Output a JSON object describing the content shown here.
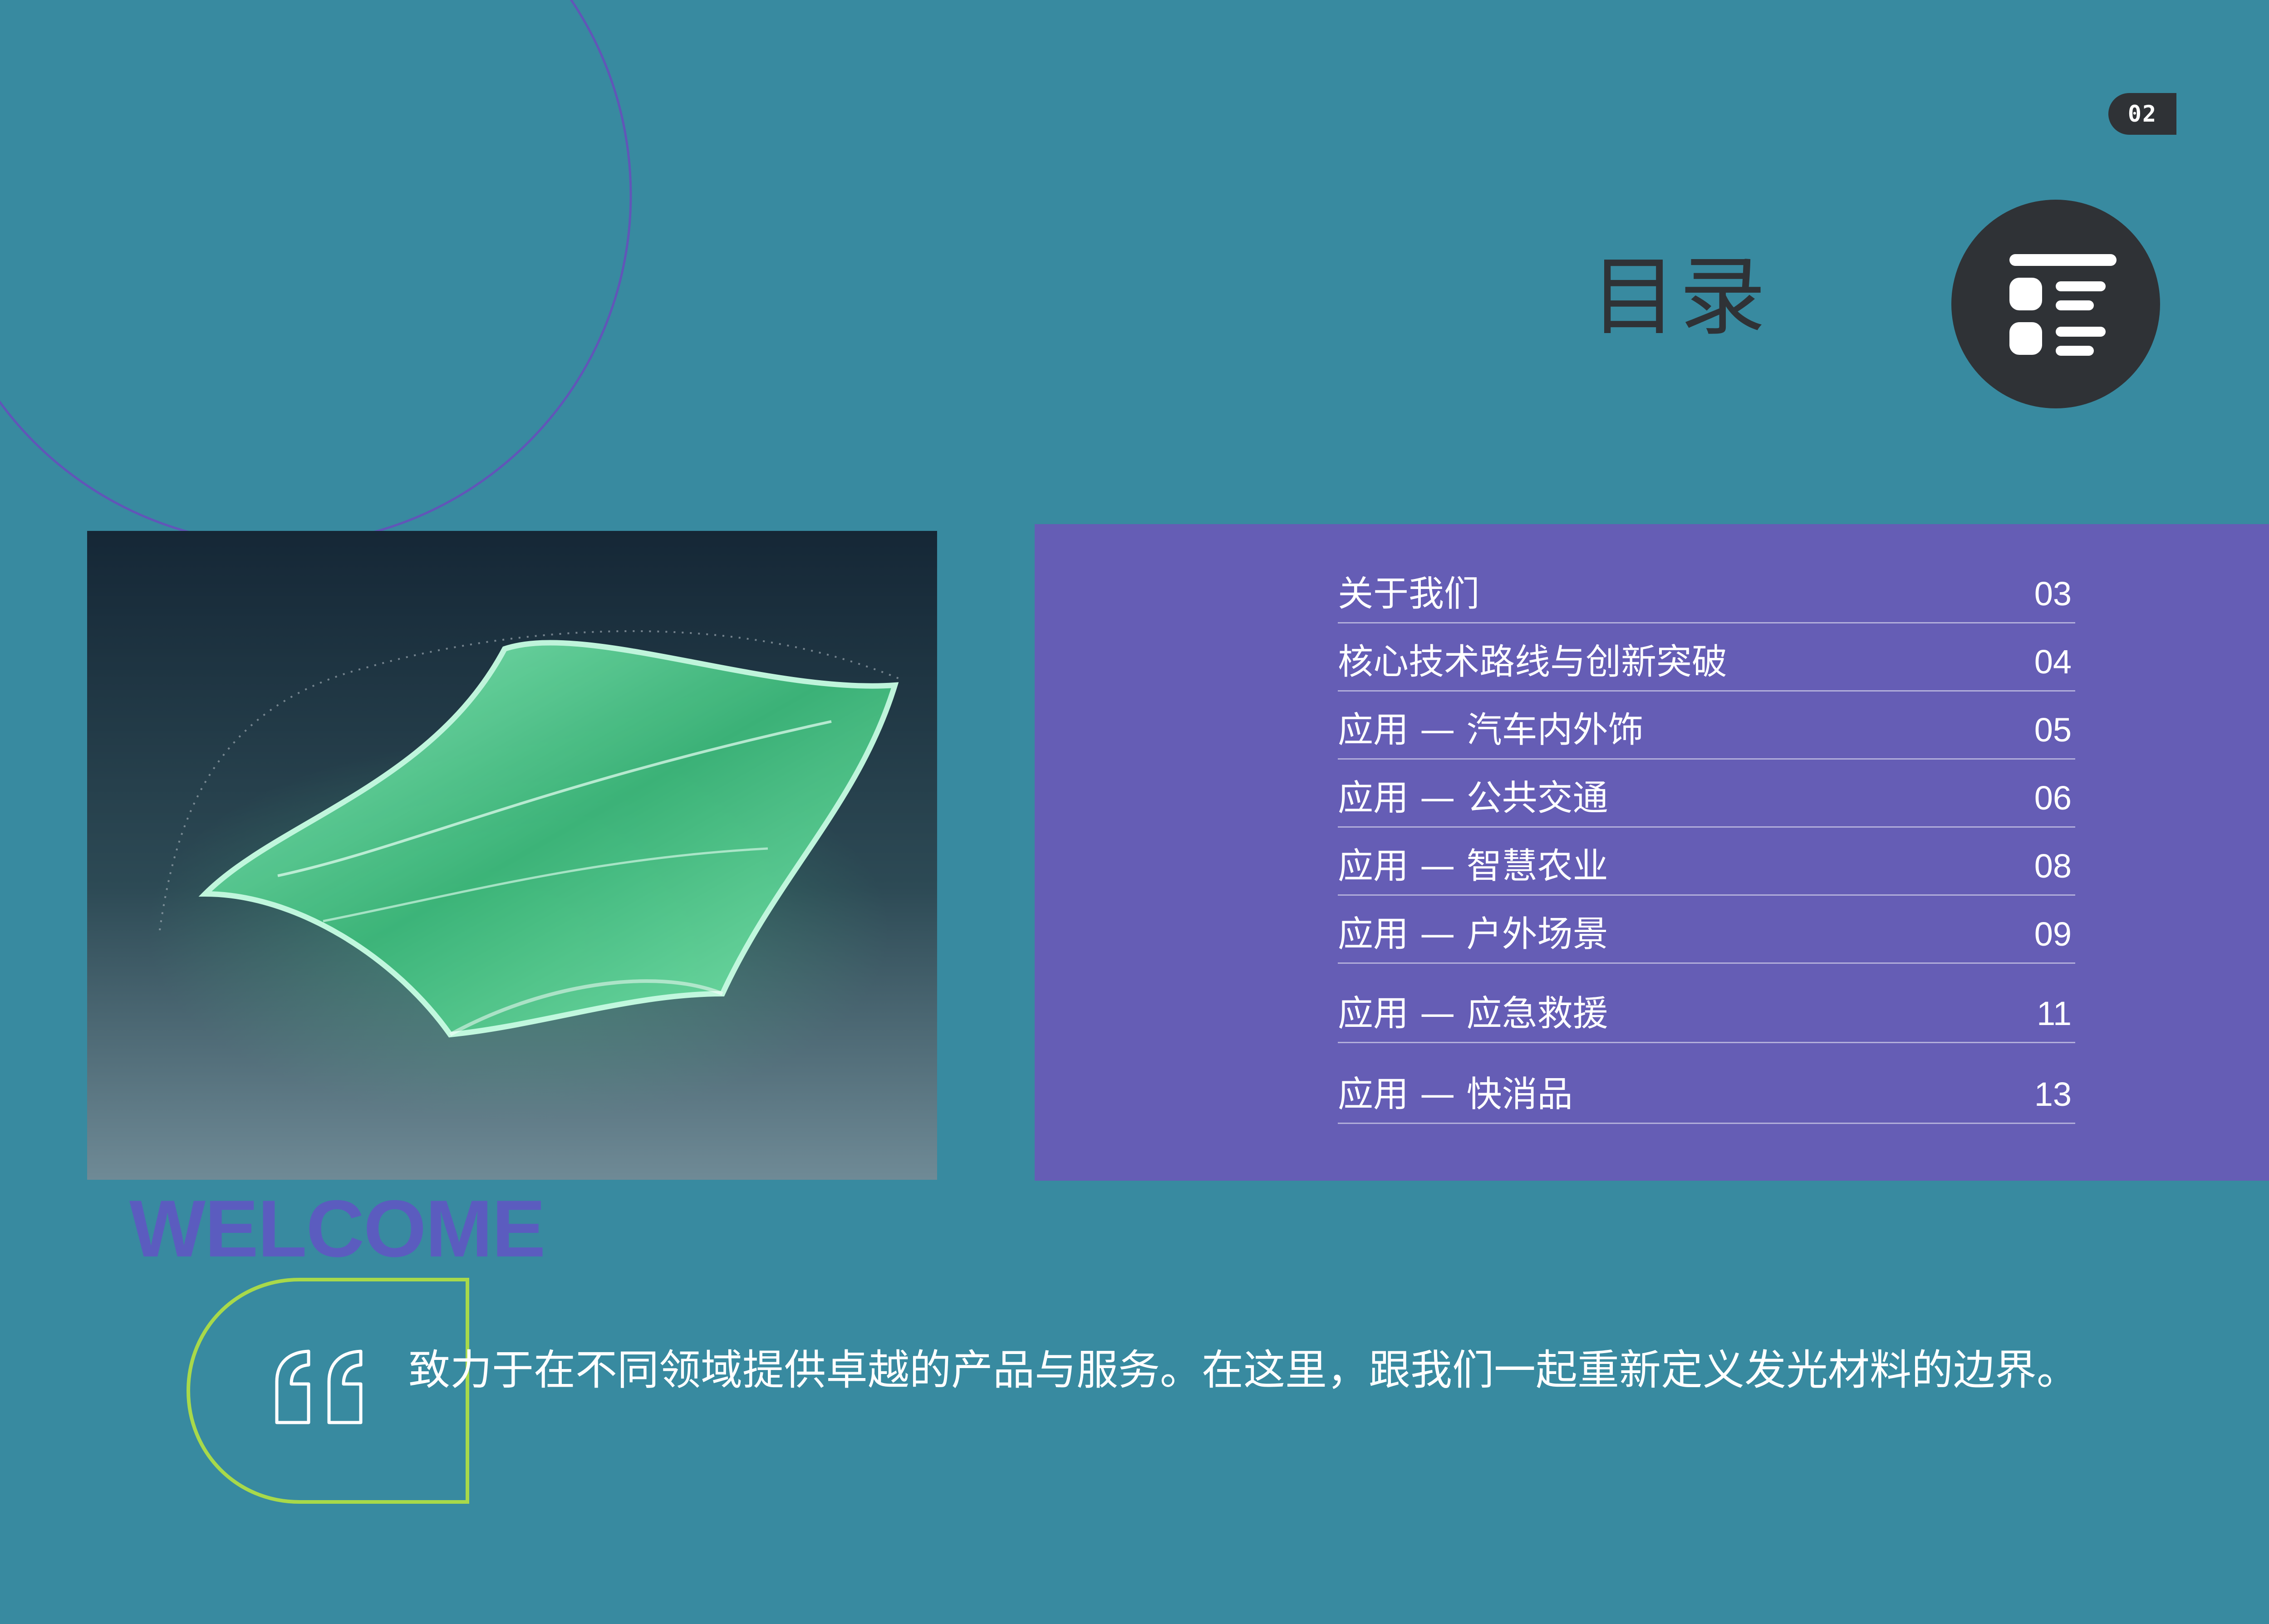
{
  "page": {
    "number": "02",
    "title": "目录"
  },
  "toc": {
    "items": [
      {
        "label": "关于我们",
        "page": "03"
      },
      {
        "label": "核心技术路线与创新突破",
        "page": "04"
      },
      {
        "label": "应用 — 汽车内外饰",
        "page": "05"
      },
      {
        "label": "应用 — 公共交通",
        "page": "06"
      },
      {
        "label": "应用 — 智慧农业",
        "page": "08"
      },
      {
        "label": "应用 — 户外场景",
        "page": "09"
      },
      {
        "label": "应用 — 应急救援",
        "page": "11"
      },
      {
        "label": "应用 — 快消品",
        "page": "13"
      }
    ]
  },
  "welcome": "WELCOME",
  "tagline": "致力于在不同领域提供卓越的产品与服务。在这里，跟我们一起重新定义发光材料的边界。",
  "icons": {
    "menu": "list-menu-icon",
    "quote": "quote-icon"
  },
  "colors": {
    "background": "#388aa0",
    "panel": "#655db5",
    "dark": "#2f3236",
    "welcome": "#5b5cbf",
    "quote_outline": "#a8d94a",
    "glow": "#4fd08f"
  }
}
